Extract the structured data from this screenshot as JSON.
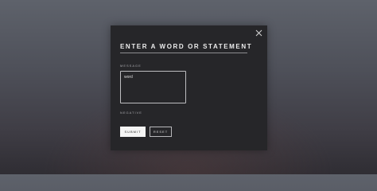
{
  "modal": {
    "title": "ENTER A WORD OR STATEMENT",
    "close_icon": "close-icon"
  },
  "form": {
    "message_label": "MESSAGE",
    "message_value": "word",
    "result_label": "NEGATIVE",
    "submit_label": "SUBMIT",
    "reset_label": "RESET"
  },
  "colors": {
    "modal_background": "#262629",
    "title_text": "#ececec",
    "primary_button": "#f4f4f4"
  }
}
